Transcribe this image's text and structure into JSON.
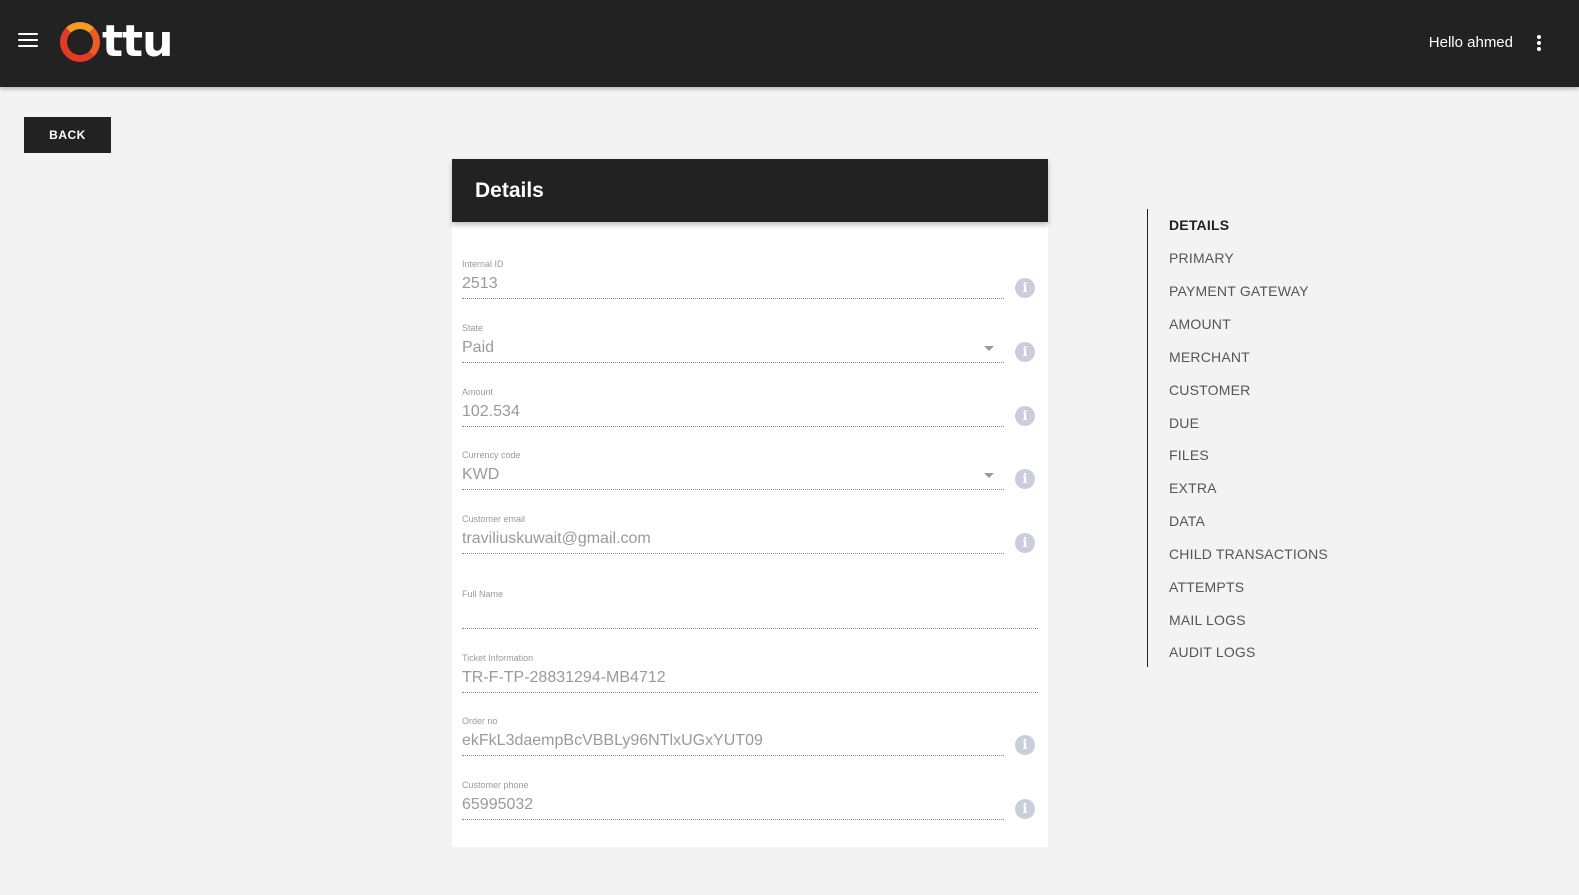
{
  "header": {
    "logo_text": "ttu",
    "greeting": "Hello ahmed"
  },
  "back_label": "BACK",
  "card": {
    "title": "Details",
    "fields": [
      {
        "label": "Internal ID",
        "value": "2513",
        "has_info": true,
        "dropdown": false
      },
      {
        "label": "State",
        "value": "Paid",
        "has_info": true,
        "dropdown": true
      },
      {
        "label": "Amount",
        "value": "102.534",
        "has_info": true,
        "dropdown": false
      },
      {
        "label": "Currency code",
        "value": "KWD",
        "has_info": true,
        "dropdown": true
      },
      {
        "label": "Customer email",
        "value": "traviliuskuwait@gmail.com",
        "has_info": true,
        "dropdown": false
      },
      {
        "label": "Full Name",
        "value": "",
        "has_info": false,
        "dropdown": false
      },
      {
        "label": "Ticket Information",
        "value": "TR-F-TP-28831294-MB4712",
        "has_info": false,
        "dropdown": false
      },
      {
        "label": "Order no",
        "value": "ekFkL3daempBcVBBLy96NTlxUGxYUT09",
        "has_info": true,
        "dropdown": false
      },
      {
        "label": "Customer phone",
        "value": "65995032",
        "has_info": true,
        "dropdown": false
      }
    ]
  },
  "toc": {
    "active_index": 0,
    "items": [
      "DETAILS",
      "PRIMARY",
      "PAYMENT GATEWAY",
      "AMOUNT",
      "MERCHANT",
      "CUSTOMER",
      "DUE",
      "FILES",
      "EXTRA",
      "DATA",
      "CHILD TRANSACTIONS",
      "ATTEMPTS",
      "MAIL LOGS",
      "AUDIT LOGS"
    ]
  },
  "colors": {
    "header_bg": "#222222",
    "page_bg": "#f3f3f3",
    "logo_accent": "#e33a26",
    "info_icon": "#c9cfda"
  }
}
